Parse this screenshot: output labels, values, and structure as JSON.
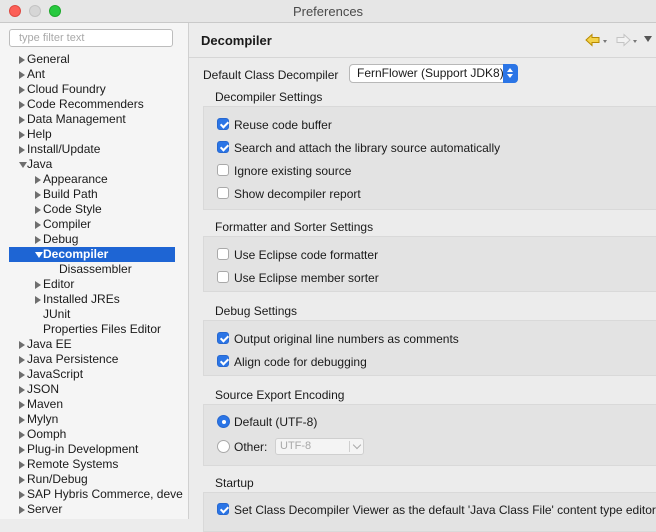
{
  "window": {
    "title": "Preferences"
  },
  "filter": {
    "placeholder": "type filter text"
  },
  "tree": [
    {
      "label": "General",
      "level": 0,
      "twisty": "closed"
    },
    {
      "label": "Ant",
      "level": 0,
      "twisty": "closed"
    },
    {
      "label": "Cloud Foundry",
      "level": 0,
      "twisty": "closed"
    },
    {
      "label": "Code Recommenders",
      "level": 0,
      "twisty": "closed"
    },
    {
      "label": "Data Management",
      "level": 0,
      "twisty": "closed"
    },
    {
      "label": "Help",
      "level": 0,
      "twisty": "closed"
    },
    {
      "label": "Install/Update",
      "level": 0,
      "twisty": "closed"
    },
    {
      "label": "Java",
      "level": 0,
      "twisty": "open"
    },
    {
      "label": "Appearance",
      "level": 1,
      "twisty": "closed"
    },
    {
      "label": "Build Path",
      "level": 1,
      "twisty": "closed"
    },
    {
      "label": "Code Style",
      "level": 1,
      "twisty": "closed"
    },
    {
      "label": "Compiler",
      "level": 1,
      "twisty": "closed"
    },
    {
      "label": "Debug",
      "level": 1,
      "twisty": "closed"
    },
    {
      "label": "Decompiler",
      "level": 1,
      "twisty": "open",
      "selected": true
    },
    {
      "label": "Disassembler",
      "level": 2,
      "twisty": "none"
    },
    {
      "label": "Editor",
      "level": 1,
      "twisty": "closed"
    },
    {
      "label": "Installed JREs",
      "level": 1,
      "twisty": "closed"
    },
    {
      "label": "JUnit",
      "level": 1,
      "twisty": "none"
    },
    {
      "label": "Properties Files Editor",
      "level": 1,
      "twisty": "none"
    },
    {
      "label": "Java EE",
      "level": 0,
      "twisty": "closed"
    },
    {
      "label": "Java Persistence",
      "level": 0,
      "twisty": "closed"
    },
    {
      "label": "JavaScript",
      "level": 0,
      "twisty": "closed"
    },
    {
      "label": "JSON",
      "level": 0,
      "twisty": "closed"
    },
    {
      "label": "Maven",
      "level": 0,
      "twisty": "closed"
    },
    {
      "label": "Mylyn",
      "level": 0,
      "twisty": "closed"
    },
    {
      "label": "Oomph",
      "level": 0,
      "twisty": "closed"
    },
    {
      "label": "Plug-in Development",
      "level": 0,
      "twisty": "closed"
    },
    {
      "label": "Remote Systems",
      "level": 0,
      "twisty": "closed"
    },
    {
      "label": "Run/Debug",
      "level": 0,
      "twisty": "closed"
    },
    {
      "label": "SAP Hybris Commerce, deve",
      "level": 0,
      "twisty": "closed"
    },
    {
      "label": "Server",
      "level": 0,
      "twisty": "closed"
    }
  ],
  "page": {
    "title": "Decompiler",
    "default_decompiler_label": "Default Class Decompiler",
    "default_decompiler_value": "FernFlower (Support JDK8)",
    "sections": {
      "decompiler": {
        "title": "Decompiler Settings",
        "items": [
          {
            "label": "Reuse code buffer",
            "checked": true
          },
          {
            "label": "Search and attach the library source automatically",
            "checked": true
          },
          {
            "label": "Ignore existing source",
            "checked": false
          },
          {
            "label": "Show decompiler report",
            "checked": false
          }
        ]
      },
      "formatter": {
        "title": "Formatter and Sorter Settings",
        "items": [
          {
            "label": "Use Eclipse code formatter",
            "checked": false
          },
          {
            "label": "Use Eclipse member sorter",
            "checked": false
          }
        ]
      },
      "debug": {
        "title": "Debug Settings",
        "items": [
          {
            "label": "Output original line numbers as comments",
            "checked": true
          },
          {
            "label": "Align code for debugging",
            "checked": true
          }
        ]
      },
      "encoding": {
        "title": "Source Export Encoding",
        "default_label": "Default (UTF-8)",
        "default_selected": true,
        "other_label": "Other:",
        "other_selected": false,
        "other_value": "UTF-8"
      },
      "startup": {
        "title": "Startup",
        "items": [
          {
            "label": "Set Class Decompiler Viewer as the default 'Java Class File' content type editor",
            "checked": true
          }
        ]
      }
    }
  },
  "colors": {
    "accent": "#2b75e6",
    "selection": "#1e65d4",
    "back_arrow": "#e8b100"
  }
}
